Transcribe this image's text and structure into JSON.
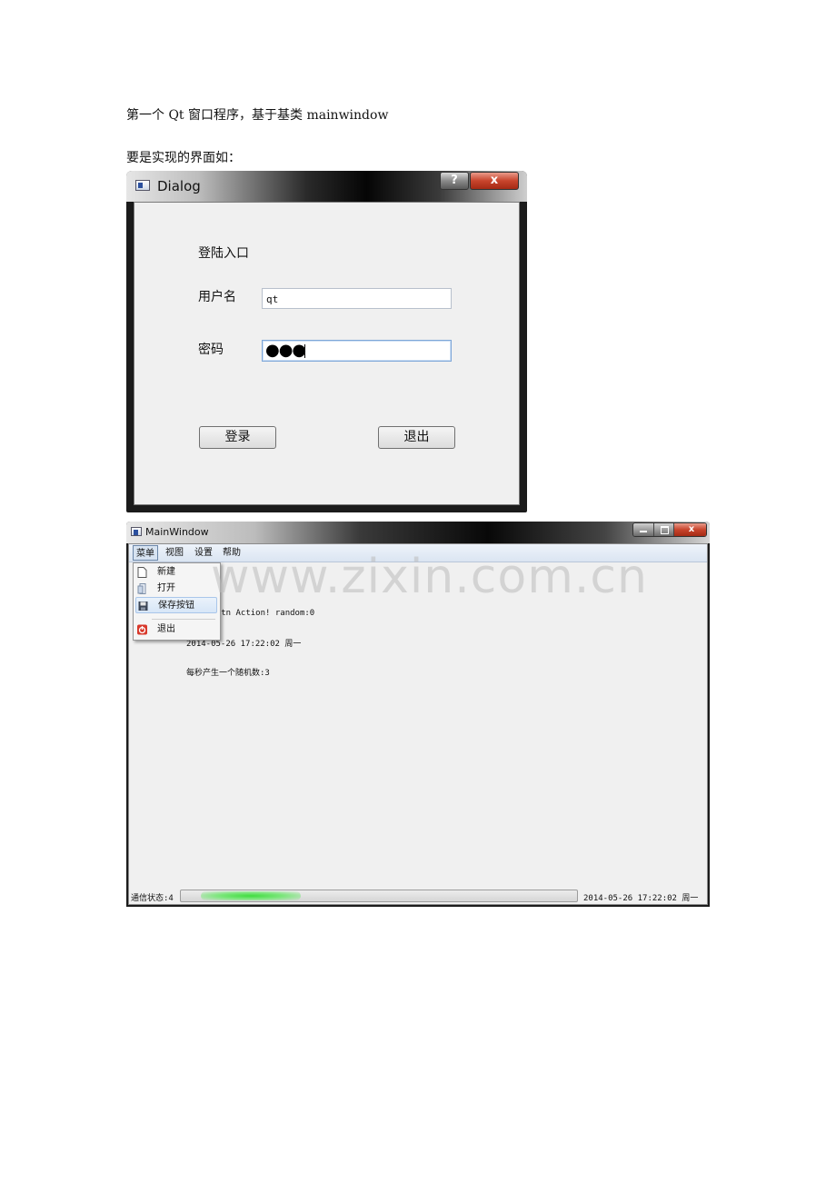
{
  "document": {
    "line1": "第一个 Qt 窗口程序，基于基类 mainwindow",
    "line2": "要是实现的界面如："
  },
  "dialog": {
    "title": "Dialog",
    "help_glyph": "?",
    "close_glyph": "x",
    "heading": "登陆入口",
    "username_label": "用户名",
    "username_value": "qt",
    "password_label": "密码",
    "password_mask": "●●●",
    "login_button": "登录",
    "exit_button": "退出"
  },
  "mainwindow": {
    "title": "MainWindow",
    "menus": [
      "菜单",
      "视图",
      "设置",
      "帮助"
    ],
    "open_menu_items": [
      {
        "label": "新建",
        "icon": "new-file-icon"
      },
      {
        "label": "打开",
        "icon": "open-file-icon"
      },
      {
        "label": "保存按钮",
        "icon": "save-icon",
        "highlighted": true
      },
      {
        "label": "退出",
        "icon": "power-icon"
      }
    ],
    "content_line1": "w_Btn Action! random:0",
    "content_line2": "2014-05-26 17:22:02  周一",
    "content_line3": "每秒产生一个随机数:3",
    "status_label": "通信状态:4",
    "status_time": "2014-05-26 17:22:02  周一"
  },
  "watermark": "www.zixin.com.cn",
  "colors": {
    "window_frame": "#1b1b1b",
    "client_bg": "#f0f0f0",
    "close_red": "#c8442c",
    "progress_green": "#3fdc3f"
  }
}
